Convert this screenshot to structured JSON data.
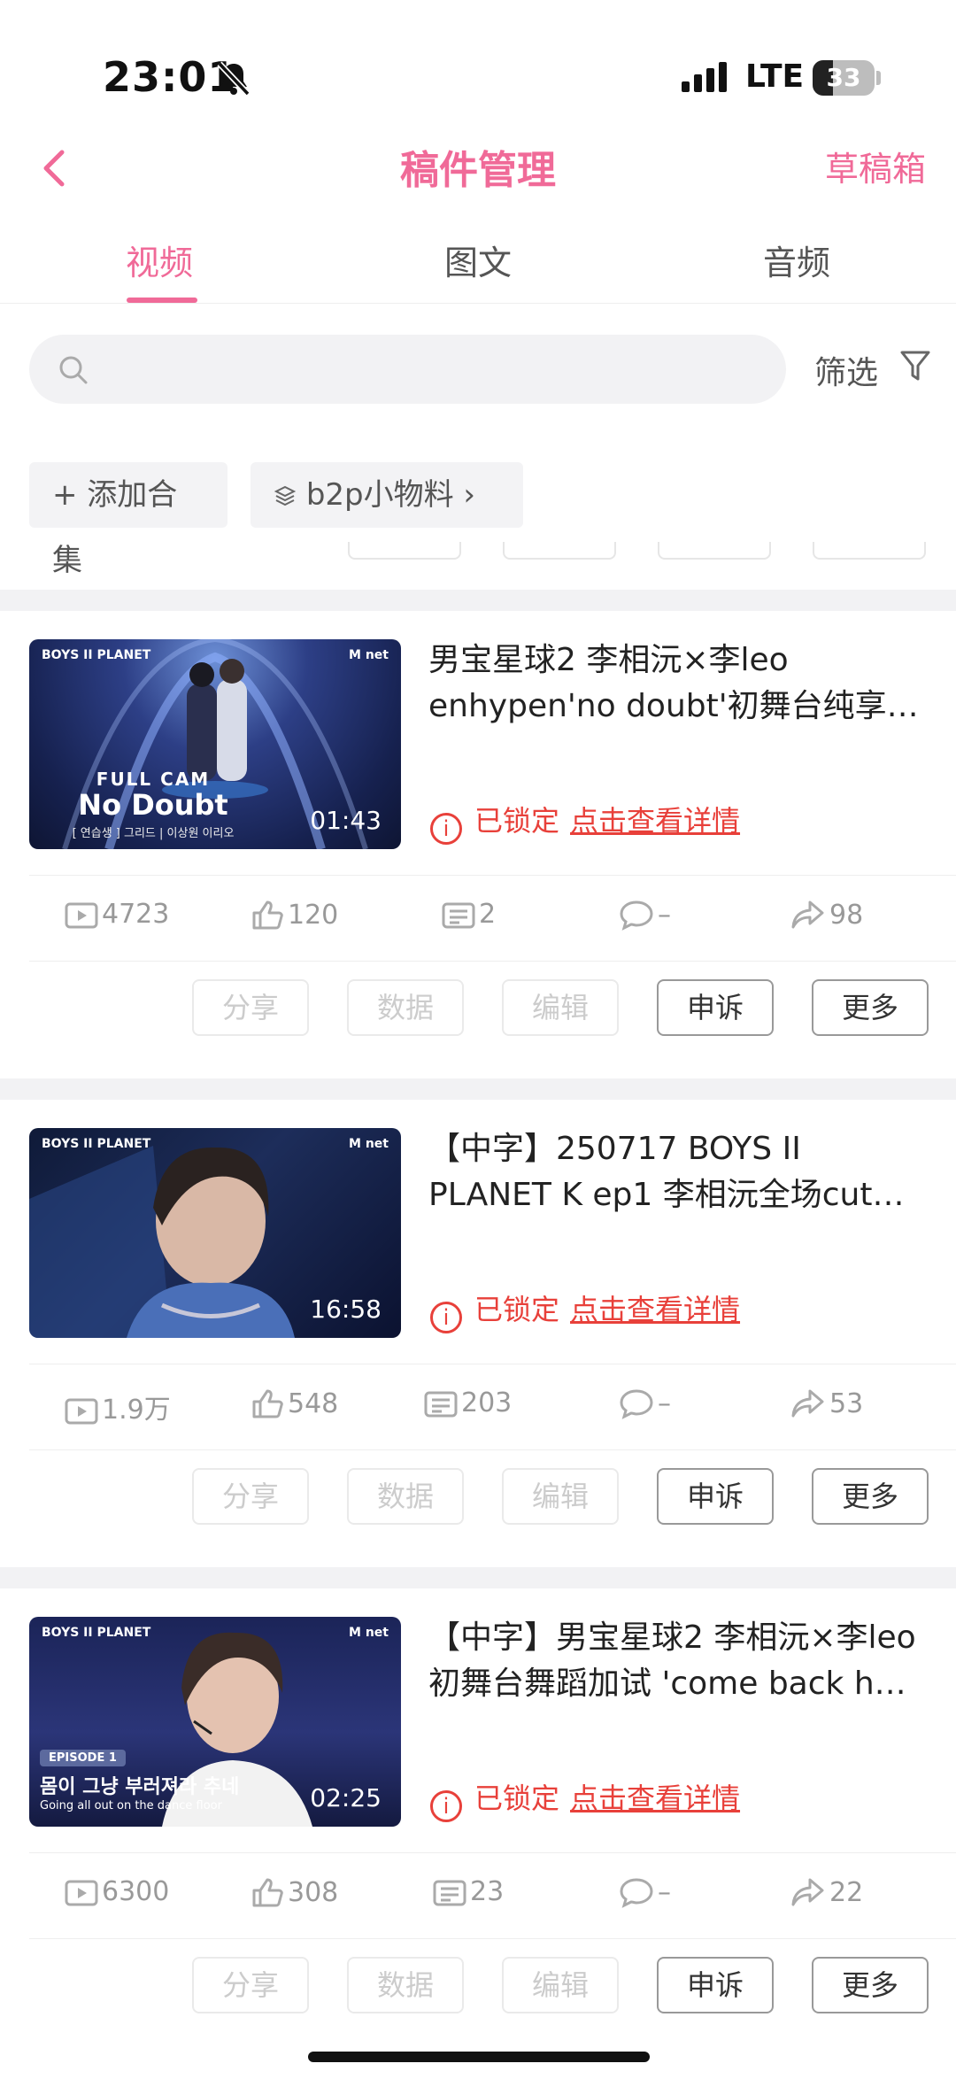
{
  "status_bar": {
    "time": "23:01",
    "network": "LTE",
    "battery": "33",
    "battery_level": 0.33
  },
  "nav": {
    "title": "稿件管理",
    "right_label": "草稿箱"
  },
  "tabs": [
    {
      "label": "视频",
      "active": true
    },
    {
      "label": "图文",
      "active": false
    },
    {
      "label": "音频",
      "active": false
    }
  ],
  "search": {
    "placeholder": ""
  },
  "filter_label": "筛选",
  "chips": {
    "add_label": "+ 添加合集",
    "collection_label": "b2p小物料 ›"
  },
  "action_labels": {
    "share": "分享",
    "data": "数据",
    "edit": "编辑",
    "appeal": "申诉",
    "more": "更多"
  },
  "videos": [
    {
      "title": "男宝星球2 李相沅×李leo enhypen'no doubt'初舞台纯享…",
      "duration": "01:43",
      "locked_label": "已锁定",
      "locked_link": "点击查看详情",
      "stats": {
        "plays": "4723",
        "likes": "120",
        "comments": "2",
        "danmaku": "–",
        "shares": "98"
      },
      "thumb_caption": "FULL CAM",
      "thumb_subtitle": "No Doubt",
      "thumb_credit": "[ 연습생 ] 그리드 | 이상원 이리오",
      "thumb_brand_left": "BOYS II PLANET",
      "thumb_brand_right": "M net"
    },
    {
      "title": "【中字】250717 BOYS II PLANET K ep1 李相沅全场cut…",
      "duration": "16:58",
      "locked_label": "已锁定",
      "locked_link": "点击查看详情",
      "stats": {
        "plays": "1.9万",
        "likes": "548",
        "comments": "203",
        "danmaku": "–",
        "shares": "53"
      },
      "thumb_brand_left": "BOYS II PLANET",
      "thumb_brand_right": "M net"
    },
    {
      "title": "【中字】男宝星球2 李相沅×李leo 初舞台舞蹈加试 'come back h…",
      "duration": "02:25",
      "locked_label": "已锁定",
      "locked_link": "点击查看详情",
      "stats": {
        "plays": "6300",
        "likes": "308",
        "comments": "23",
        "danmaku": "–",
        "shares": "22"
      },
      "thumb_badge": "EPISODE 1",
      "thumb_caption": "몸이 그냥 부러져라 추네",
      "thumb_subtitle": "Going all out on the dance floor",
      "thumb_brand_left": "BOYS II PLANET",
      "thumb_brand_right": "M net"
    }
  ]
}
